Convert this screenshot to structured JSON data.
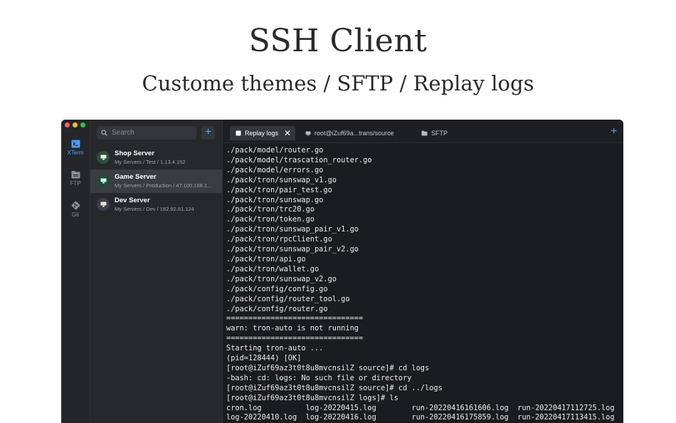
{
  "hero": {
    "title": "SSH Client",
    "subtitle": "Custome themes / SFTP / Replay logs"
  },
  "window_controls": [
    "#ff5f57",
    "#febc2e",
    "#28c840"
  ],
  "rail": {
    "items": [
      {
        "label": "XTerm",
        "icon": "terminal-icon",
        "active": true
      },
      {
        "label": "FTP",
        "icon": "folder-icon",
        "active": false
      },
      {
        "label": "Git",
        "icon": "git-icon",
        "active": false
      }
    ]
  },
  "sidebar": {
    "search_placeholder": "Search",
    "add_label": "+",
    "servers": [
      {
        "name": "Shop Server",
        "path": "My Servers / Test / 1.13.4.152",
        "avatar_color": "#2f4e3b"
      },
      {
        "name": "Game Server",
        "path": "My Servers / Production / 47.100.168.1...",
        "avatar_color": "#1c4b3c"
      },
      {
        "name": "Dev Server",
        "path": "My Servers / Dev / 182.92.81.124",
        "avatar_color": "#3a3d55"
      }
    ]
  },
  "tabs": [
    {
      "label": "Replay logs",
      "active": true
    },
    {
      "label": "root@iZuf69a...trans/source",
      "active": false
    },
    {
      "label": "SFTP",
      "active": false
    }
  ],
  "tab_close": "✕",
  "new_tab_label": "+",
  "colors": {
    "accent": "#4aa3ff",
    "terminal_bg": "#1a1c1f",
    "terminal_text": "#e7efe9"
  },
  "terminal": {
    "lines": [
      "./pack/model/router.go",
      "./pack/model/trascation_router.go",
      "./pack/model/errors.go",
      "./pack/tron/sunswap_v1.go",
      "./pack/tron/pair_test.go",
      "./pack/tron/sunswap.go",
      "./pack/tron/trc20.go",
      "./pack/tron/token.go",
      "./pack/tron/sunswap_pair_v1.go",
      "./pack/tron/rpcClient.go",
      "./pack/tron/sunswap_pair_v2.go",
      "./pack/tron/api.go",
      "./pack/tron/wallet.go",
      "./pack/tron/sunswap_v2.go",
      "./pack/config/config.go",
      "./pack/config/router_tool.go",
      "./pack/config/router.go",
      "===============================",
      "warn: tron-auto is not running",
      "===============================",
      "Starting tron-auto ...",
      "(pid=128444) [OK]",
      "[root@iZuf69az3t0t8u8mvcnsilZ source]# cd logs",
      "-bash: cd: logs: No such file or directory",
      "[root@iZuf69az3t0t8u8mvcnsilZ source]# cd ../logs",
      "[root@iZuf69az3t0t8u8mvcnsilZ logs]# ls",
      "cron.log          log-20220415.log        run-20220416161606.log  run-20220417112725.log",
      "log-20220410.log  log-20220416.log        run-20220416175859.log  run-20220417113415.log"
    ]
  }
}
